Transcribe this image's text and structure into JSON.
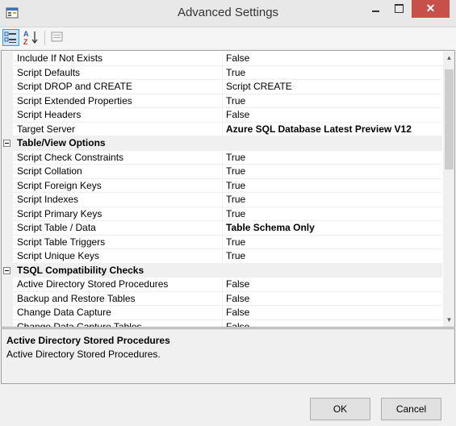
{
  "window": {
    "title": "Advanced Settings",
    "close_glyph": "✕"
  },
  "toolbar": {
    "items": [
      {
        "name": "categorized-icon",
        "pressed": true
      },
      {
        "name": "alphabetical-sort-icon",
        "pressed": false
      },
      {
        "name": "property-pages-icon",
        "pressed": false
      }
    ]
  },
  "grid": {
    "rows": [
      {
        "type": "prop",
        "name": "Include If Not Exists",
        "value": "False",
        "bold": false
      },
      {
        "type": "prop",
        "name": "Script Defaults",
        "value": "True",
        "bold": false
      },
      {
        "type": "prop",
        "name": "Script DROP and CREATE",
        "value": "Script CREATE",
        "bold": false
      },
      {
        "type": "prop",
        "name": "Script Extended Properties",
        "value": "True",
        "bold": false
      },
      {
        "type": "prop",
        "name": "Script Headers",
        "value": "False",
        "bold": false
      },
      {
        "type": "prop",
        "name": "Target Server",
        "value": "Azure SQL Database Latest Preview V12",
        "bold": true
      },
      {
        "type": "cat",
        "name": "Table/View Options"
      },
      {
        "type": "prop",
        "name": "Script Check Constraints",
        "value": "True",
        "bold": false
      },
      {
        "type": "prop",
        "name": "Script Collation",
        "value": "True",
        "bold": false
      },
      {
        "type": "prop",
        "name": "Script Foreign Keys",
        "value": "True",
        "bold": false
      },
      {
        "type": "prop",
        "name": "Script Indexes",
        "value": "True",
        "bold": false
      },
      {
        "type": "prop",
        "name": "Script Primary Keys",
        "value": "True",
        "bold": false
      },
      {
        "type": "prop",
        "name": "Script Table / Data",
        "value": "Table Schema Only",
        "bold": true
      },
      {
        "type": "prop",
        "name": "Script Table Triggers",
        "value": "True",
        "bold": false
      },
      {
        "type": "prop",
        "name": "Script Unique Keys",
        "value": "True",
        "bold": false
      },
      {
        "type": "cat",
        "name": "TSQL Compatibility Checks"
      },
      {
        "type": "prop",
        "name": "Active Directory Stored Procedures",
        "value": "False",
        "bold": false
      },
      {
        "type": "prop",
        "name": "Backup and Restore Tables",
        "value": "False",
        "bold": false
      },
      {
        "type": "prop",
        "name": "Change Data Capture",
        "value": "False",
        "bold": false
      },
      {
        "type": "prop",
        "name": "Change Data Capture Tables",
        "value": "False",
        "bold": false
      }
    ]
  },
  "scrollbar": {
    "up_glyph": "▲",
    "down_glyph": "▼"
  },
  "help": {
    "title": "Active Directory Stored Procedures",
    "description": "Active Directory Stored Procedures."
  },
  "buttons": {
    "ok": "OK",
    "cancel": "Cancel"
  }
}
